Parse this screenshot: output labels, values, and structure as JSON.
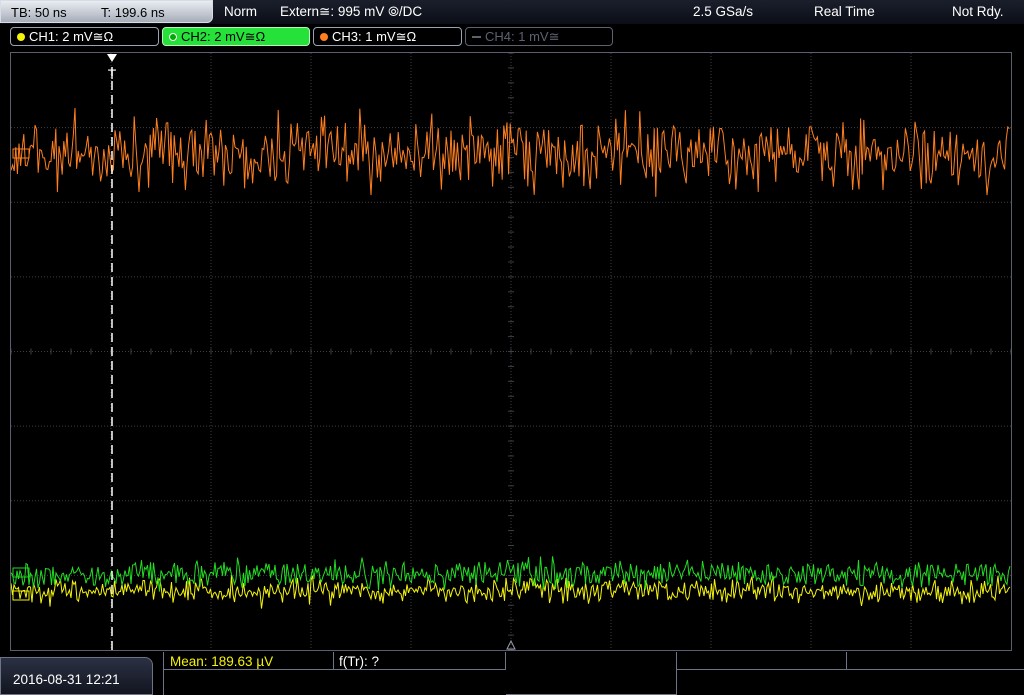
{
  "status": {
    "timebase": "TB: 50 ns",
    "trigger_time": "T: 199.6 ns",
    "acq_mode": "Norm",
    "trigger_source": "Extern≅: 995 mV ⦾/DC",
    "sample_rate": "2.5 GSa/s",
    "mode": "Real Time",
    "state": "Not Rdy."
  },
  "channels": [
    {
      "label": "CH1: 2 mV≅Ω",
      "color": "#f4f40a"
    },
    {
      "label": "CH2: 2 mV≅Ω",
      "color": "#22dd22"
    },
    {
      "label": "CH3: 1 mV≅Ω",
      "color": "#ff7f1f"
    },
    {
      "label": "CH4: 1 mV≅",
      "color": "#5d6270"
    }
  ],
  "trigger_marker": "T",
  "timestamp": "2016-08-31 12:21",
  "measurements": {
    "mean": "Mean: 189.63 µV",
    "ftr": "f(Tr): ?"
  },
  "colors": {
    "ch1": "#f4f40a",
    "ch2": "#22dd22",
    "ch3": "#ff7f1f",
    "grid": "#3c3f48"
  }
}
